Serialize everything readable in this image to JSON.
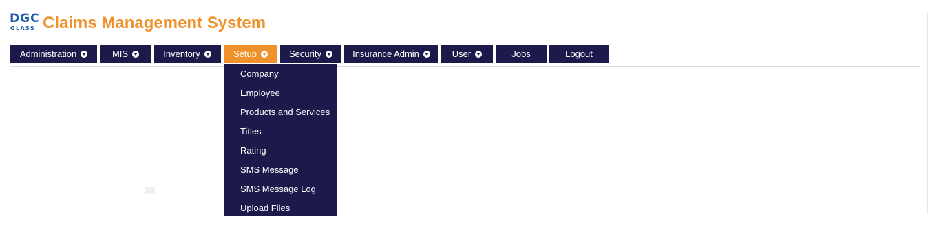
{
  "header": {
    "logo_top": "DGC",
    "logo_bottom": "GLASS",
    "title": "Claims Management System",
    "brand_color": "#f0922b"
  },
  "nav": {
    "items": [
      {
        "label": "Administration",
        "has_dropdown": true,
        "active": false
      },
      {
        "label": "MIS",
        "has_dropdown": true,
        "active": false
      },
      {
        "label": "Inventory",
        "has_dropdown": true,
        "active": false
      },
      {
        "label": "Setup",
        "has_dropdown": true,
        "active": true
      },
      {
        "label": "Security",
        "has_dropdown": true,
        "active": false
      },
      {
        "label": "Insurance Admin",
        "has_dropdown": true,
        "active": false
      },
      {
        "label": "User",
        "has_dropdown": true,
        "active": false
      },
      {
        "label": "Jobs",
        "has_dropdown": false,
        "active": false
      },
      {
        "label": "Logout",
        "has_dropdown": false,
        "active": false
      }
    ],
    "bg_color": "#1b1a4b",
    "active_color": "#f0922b"
  },
  "setup_menu": {
    "items": [
      "Company",
      "Employee",
      "Products and Services",
      "Titles",
      "Rating",
      "SMS Message",
      "SMS Message Log",
      "Upload Files"
    ]
  }
}
